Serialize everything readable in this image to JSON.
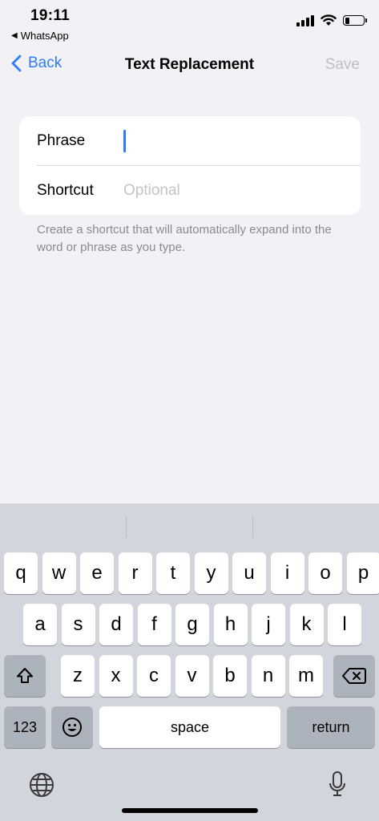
{
  "status": {
    "time": "19:11",
    "back_app": "WhatsApp",
    "battery_level": 0.25
  },
  "nav": {
    "back_label": "Back",
    "title": "Text Replacement",
    "save_label": "Save"
  },
  "form": {
    "phrase_label": "Phrase",
    "phrase_value": "",
    "shortcut_label": "Shortcut",
    "shortcut_placeholder": "Optional",
    "helper_text": "Create a shortcut that will automatically expand into the word or phrase as you type."
  },
  "keyboard": {
    "row1": [
      "q",
      "w",
      "e",
      "r",
      "t",
      "y",
      "u",
      "i",
      "o",
      "p"
    ],
    "row2": [
      "a",
      "s",
      "d",
      "f",
      "g",
      "h",
      "j",
      "k",
      "l"
    ],
    "row3": [
      "z",
      "x",
      "c",
      "v",
      "b",
      "n",
      "m"
    ],
    "numbers_label": "123",
    "space_label": "space",
    "return_label": "return",
    "icons": {
      "shift": "shift-icon",
      "delete": "delete-icon",
      "emoji": "emoji-icon",
      "globe": "globe-icon",
      "mic": "microphone-icon"
    }
  }
}
